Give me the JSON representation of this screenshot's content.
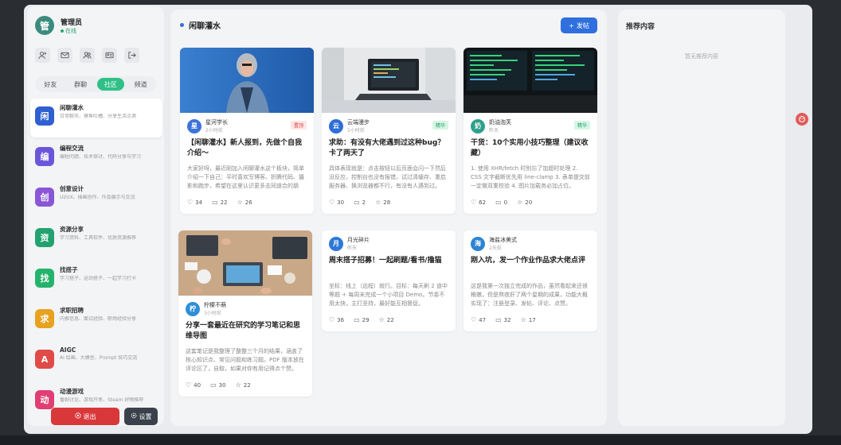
{
  "user": {
    "avatar_char": "管",
    "name": "管理员",
    "status": "在线"
  },
  "toolbar_icons": [
    "add-user-icon",
    "mail-icon",
    "users-icon",
    "id-card-icon",
    "logout-icon"
  ],
  "tabs": [
    {
      "label": "好友",
      "active": false
    },
    {
      "label": "群聊",
      "active": false
    },
    {
      "label": "社区",
      "active": true
    },
    {
      "label": "频道",
      "active": false
    }
  ],
  "channels": [
    {
      "char": "闲",
      "title": "闲聊灌水",
      "desc": "日常聊天、摸鱼吐槽、分享生活点滴",
      "color": "#2f5fd0",
      "active": true
    },
    {
      "char": "编",
      "title": "编程交流",
      "desc": "编程问题、技术探讨、代码分享与学习",
      "color": "#6a56d8",
      "active": false
    },
    {
      "char": "创",
      "title": "创意设计",
      "desc": "UI/UX、插画创作、作品展示与交流",
      "color": "#8a55d6",
      "active": false
    },
    {
      "char": "资",
      "title": "资源分享",
      "desc": "学习资料、工具软件、优质资源推荐",
      "color": "#22a26f",
      "active": false
    },
    {
      "char": "找",
      "title": "找搭子",
      "desc": "学习搭子、运动搭子、一起学习打卡",
      "color": "#25b36c",
      "active": false
    },
    {
      "char": "求",
      "title": "求职招聘",
      "desc": "内推信息、面试经验、职场经验分享",
      "color": "#e8a21f",
      "active": false
    },
    {
      "char": "A",
      "title": "AIGC",
      "desc": "AI 绘画、大模型、Prompt 技巧交流",
      "color": "#e04b48",
      "active": false
    },
    {
      "char": "动",
      "title": "动漫游戏",
      "desc": "番剧讨论、游戏开黑、Steam 好物推荐",
      "color": "#e03f73",
      "active": false
    }
  ],
  "buttons": {
    "exit": "退出",
    "settings": "设置",
    "post": "发帖"
  },
  "main": {
    "title": "闲聊灌水"
  },
  "posts": [
    {
      "author": "星河学长",
      "avatar_char": "星",
      "avatar_color": "#3d73d8",
      "time": "2小时前",
      "tag": "置顶",
      "tag_type": "hot",
      "title": "【闲聊灌水】新人报到，先做个自我介绍～",
      "excerpt": "大家好呀，最近刚加入闲聊灌水这个板块，简单介绍一下自己：平时喜欢写博客、折腾代码、摄影和跑步，希望在这里认识更多志同道合的朋友。",
      "likes": "34",
      "comments": "22",
      "stars": "26",
      "image": "person"
    },
    {
      "author": "云端漫步",
      "avatar_char": "云",
      "avatar_color": "#2e6fd6",
      "time": "5小时前",
      "tag": "精华",
      "tag_type": "feat",
      "title": "求助：有没有大佬遇到过这种bug？卡了两天了",
      "excerpt": "具体表现就是：点击按钮以后页面会闪一下然后没反应，控制台也没有报错，试过清缓存、重启服务器、换浏览器都不行，有没有人遇到过。",
      "likes": "30",
      "comments": "2",
      "stars": "28",
      "image": "laptop"
    },
    {
      "author": "奶油泡芙",
      "avatar_char": "奶",
      "avatar_color": "#2ea08a",
      "time": "昨天",
      "tag": "精华",
      "tag_type": "feat",
      "title": "干货：10个实用小技巧整理（建议收藏）",
      "excerpt": "1. 使用 XHR/fetch 时别忘了加超时处理 2. CSS 文字截断优先用 line-clamp 3. 表单提交前一定做双重校验 4. 图片加载务必加占位。",
      "likes": "62",
      "comments": "0",
      "stars": "20",
      "image": "monitor"
    },
    {
      "author": "柠檬不萌",
      "avatar_char": "柠",
      "avatar_color": "#2e8fd8",
      "time": "3小时前",
      "tag": "",
      "tag_type": "",
      "title": "分享一套最近在研究的学习笔记和思维导图",
      "excerpt": "这套笔记是我整理了整整三个月的结果，涵盖了核心知识点、常见问题和练习题。PDF 版本放在评论区了，自取，如果对你有用记得点个赞。",
      "likes": "40",
      "comments": "30",
      "stars": "22",
      "image": "desk"
    },
    {
      "author": "月光碎片",
      "avatar_char": "月",
      "avatar_color": "#2f78d6",
      "time": "昨天",
      "tag": "",
      "tag_type": "",
      "title": "周末搭子招募！一起刷题/看书/撸猫",
      "excerpt": "坐标：线上（远程）就行。目标：每天刷 2 道中等题 + 每周末完成一个小项目 Demo。节奏不用太快，主打坚持，最好能互相督促。",
      "likes": "36",
      "comments": "29",
      "stars": "22",
      "image": ""
    },
    {
      "author": "海盐冰美式",
      "avatar_char": "海",
      "avatar_color": "#2d84d2",
      "time": "2天前",
      "tag": "",
      "tag_type": "",
      "title": "刚入坑，发一个作业作品求大佬点评",
      "excerpt": "这是我第一次独立完成的作品，虽然看起来还很稚嫩，但是熬夜肝了两个星期的成果，功能大概实现了：注册登录、发帖、评论、点赞。",
      "likes": "47",
      "comments": "32",
      "stars": "17",
      "image": ""
    }
  ],
  "recommend": {
    "title": "推荐内容",
    "empty_text": "暂无推荐内容"
  }
}
